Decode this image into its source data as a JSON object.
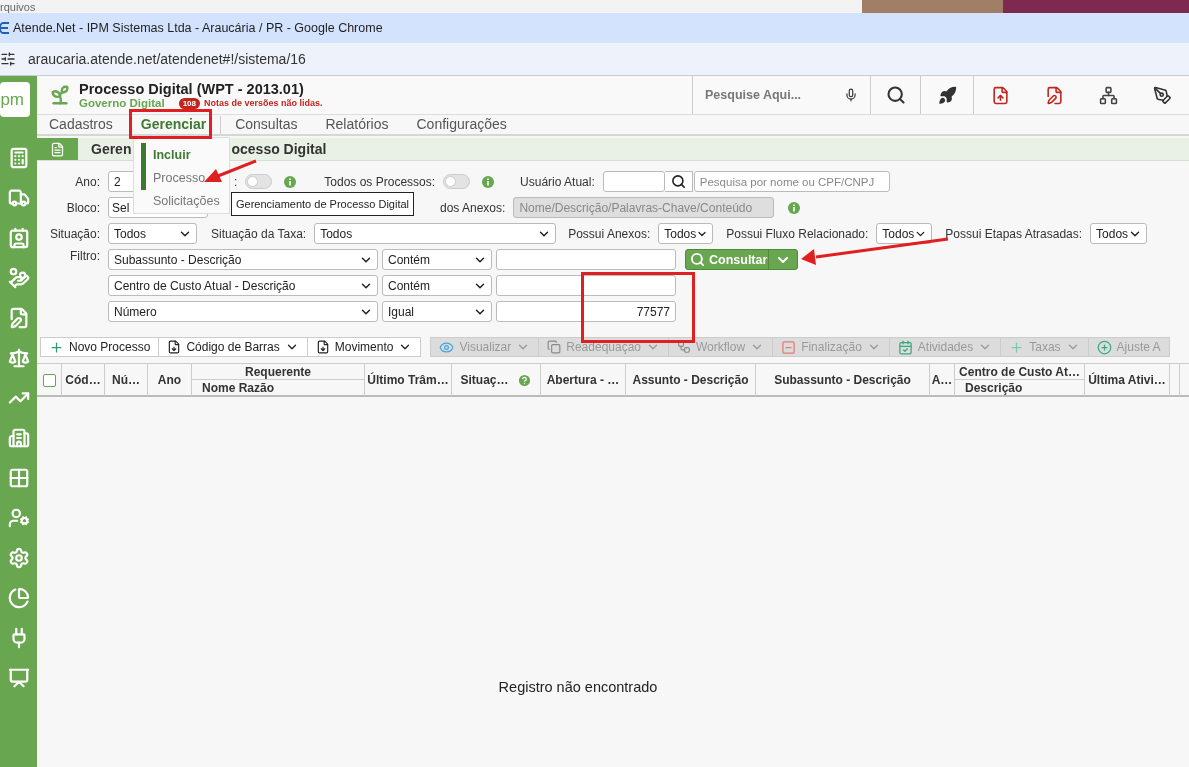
{
  "top_strip": {
    "text": "rquivos"
  },
  "browser": {
    "title": "Atende.Net - IPM Sistemas Ltda - Araucária / PR - Google Chrome",
    "url": "araucaria.atende.net/atendenet#!/sistema/16"
  },
  "sidebar": {
    "logo": "pm"
  },
  "header": {
    "title": "Processo Digital (WPT - 2013.01)",
    "subtitle": "Governo Digital",
    "badge": "108",
    "notice": "Notas de versões não lidas.",
    "search": {
      "placeholder": "Pesquise Aqui..."
    }
  },
  "menu": [
    {
      "label": "Cadastros",
      "selected": false
    },
    {
      "label": "Gerenciar",
      "selected": true
    },
    {
      "label": "Consultas",
      "selected": false
    },
    {
      "label": "Relatórios",
      "selected": false
    },
    {
      "label": "Configurações",
      "selected": false
    }
  ],
  "dropdown": [
    {
      "label": "Incluir",
      "kind": "group"
    },
    {
      "label": "Processo",
      "kind": "item",
      "selected": true
    },
    {
      "label": "Solicitações",
      "kind": "item",
      "selected": false
    }
  ],
  "tooltip": "Gerenciamento de Processo Digital",
  "panel": {
    "title_parts": [
      "Geren",
      "ocesso Digital"
    ]
  },
  "form": {
    "ano": {
      "label": "Ano:",
      "value": "2"
    },
    "toggles": [
      {
        "label": ":",
        "on": false
      },
      {
        "label": "Todos os Processos:",
        "on": false
      }
    ],
    "usuario": {
      "label": "Usuário Atual:",
      "placeholder": "Pesquisa por nome ou CPF/CNPJ"
    },
    "bloco": {
      "label": "Bloco:",
      "value": "Sel"
    },
    "anexos": {
      "label": "dos Anexos:",
      "placeholder": "Nome/Descrição/Palavras-Chave/Conteúdo",
      "disabled": true
    },
    "selects": [
      {
        "label": "Situação:",
        "value": "Todos"
      },
      {
        "label": "Situação da Taxa:",
        "value": "Todos"
      },
      {
        "label": "Possui Anexos:",
        "value": "Todos"
      },
      {
        "label": "Possui Fluxo Relacionado:",
        "value": "Todos"
      },
      {
        "label": "Possui Etapas Atrasadas:",
        "value": "Todos"
      }
    ],
    "filter": {
      "label": "Filtro:",
      "rows": [
        {
          "field": "Subassunto - Descrição",
          "operator": "Contém"
        },
        {
          "field": "Centro de Custo Atual - Descrição",
          "operator": "Contém"
        },
        {
          "field": "Número",
          "operator": "Igual",
          "value": "77577"
        }
      ]
    },
    "consult_button": "Consultar"
  },
  "toolbar": [
    {
      "label": "Novo Processo",
      "kind": "add",
      "disabled": false,
      "dropdown": false
    },
    {
      "label": "Código de Barras",
      "kind": "download",
      "disabled": false,
      "dropdown": true
    },
    {
      "label": "Movimento",
      "kind": "download",
      "disabled": false,
      "dropdown": true
    },
    {
      "label": "Visualizar",
      "kind": "view",
      "disabled": true,
      "dropdown": true
    },
    {
      "label": "Readequação",
      "kind": "copy",
      "disabled": true,
      "dropdown": true
    },
    {
      "label": "Workflow",
      "kind": "workflow",
      "disabled": true,
      "dropdown": true
    },
    {
      "label": "Finalização",
      "kind": "finish",
      "disabled": true,
      "dropdown": true
    },
    {
      "label": "Atividades",
      "kind": "calendar",
      "disabled": true,
      "dropdown": true
    },
    {
      "label": "Taxas",
      "kind": "add",
      "disabled": true,
      "dropdown": true
    },
    {
      "label": "Ajuste A",
      "kind": "adjust",
      "disabled": true,
      "dropdown": false
    }
  ],
  "table": {
    "select_all": {
      "checked": false
    },
    "columns": [
      {
        "label": "Cód…"
      },
      {
        "label": "Nú…"
      },
      {
        "label": "Ano"
      },
      {
        "label": "Requerente",
        "sub": "Nome Razão"
      },
      {
        "label": "Último Trâm…"
      },
      {
        "label": "Situaç…",
        "help": true
      },
      {
        "label": "Abertura - …"
      },
      {
        "label": "Assunto - Descrição"
      },
      {
        "label": "Subassunto - Descrição"
      },
      {
        "label": "A…"
      },
      {
        "label": "Centro de Custo At…",
        "sub": "Descrição"
      },
      {
        "label": "Última Ativi…"
      }
    ],
    "empty_message": "Registro não encontrado"
  }
}
